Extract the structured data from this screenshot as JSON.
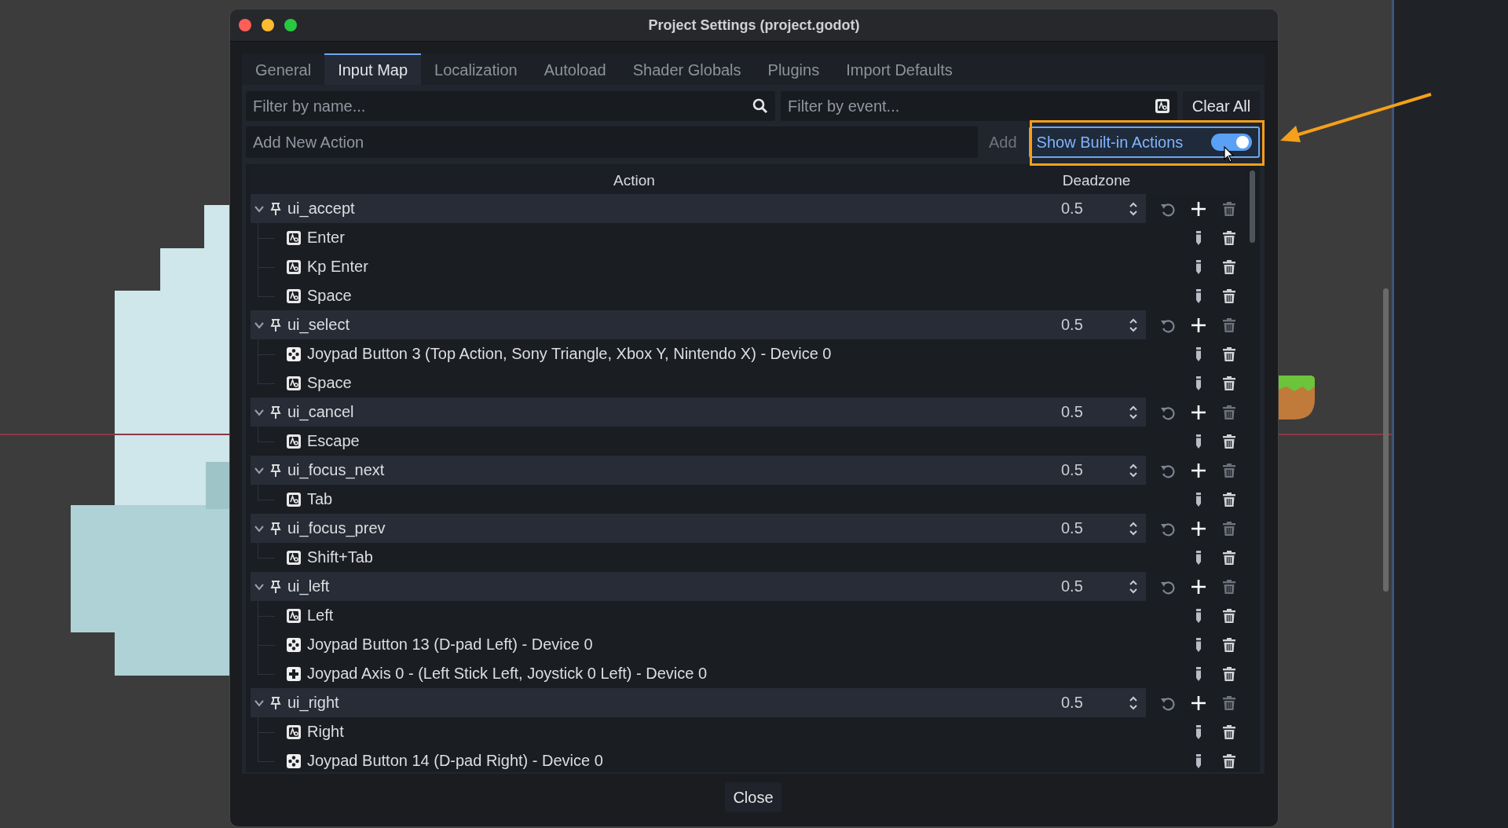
{
  "window": {
    "title": "Project Settings (project.godot)"
  },
  "tabs": [
    {
      "label": "General",
      "selected": false
    },
    {
      "label": "Input Map",
      "selected": true
    },
    {
      "label": "Localization",
      "selected": false
    },
    {
      "label": "Autoload",
      "selected": false
    },
    {
      "label": "Shader Globals",
      "selected": false
    },
    {
      "label": "Plugins",
      "selected": false
    },
    {
      "label": "Import Defaults",
      "selected": false
    }
  ],
  "filters": {
    "name_placeholder": "Filter by name...",
    "event_placeholder": "Filter by event...",
    "clear_button": "Clear All"
  },
  "add_action": {
    "placeholder": "Add New Action",
    "button": "Add",
    "button_disabled": true
  },
  "builtin_toggle": {
    "label": "Show Built-in Actions",
    "on": true
  },
  "table": {
    "columns": [
      "Action",
      "Deadzone"
    ],
    "actions": [
      {
        "name": "ui_accept",
        "expanded": true,
        "deadzone": "0.5",
        "events": [
          {
            "kind": "key",
            "label": "Enter"
          },
          {
            "kind": "key",
            "label": "Kp Enter"
          },
          {
            "kind": "key",
            "label": "Space"
          }
        ]
      },
      {
        "name": "ui_select",
        "expanded": true,
        "deadzone": "0.5",
        "events": [
          {
            "kind": "joypad_button",
            "label": "Joypad Button 3 (Top Action, Sony Triangle, Xbox Y, Nintendo X) - Device 0"
          },
          {
            "kind": "key",
            "label": "Space"
          }
        ]
      },
      {
        "name": "ui_cancel",
        "expanded": true,
        "deadzone": "0.5",
        "events": [
          {
            "kind": "key",
            "label": "Escape"
          }
        ]
      },
      {
        "name": "ui_focus_next",
        "expanded": true,
        "deadzone": "0.5",
        "events": [
          {
            "kind": "key",
            "label": "Tab"
          }
        ]
      },
      {
        "name": "ui_focus_prev",
        "expanded": true,
        "deadzone": "0.5",
        "events": [
          {
            "kind": "key",
            "label": "Shift+Tab"
          }
        ]
      },
      {
        "name": "ui_left",
        "expanded": true,
        "deadzone": "0.5",
        "events": [
          {
            "kind": "key",
            "label": "Left"
          },
          {
            "kind": "joypad_button",
            "label": "Joypad Button 13 (D-pad Left) - Device 0"
          },
          {
            "kind": "joypad_axis",
            "label": "Joypad Axis 0 - (Left Stick Left, Joystick 0 Left) - Device 0"
          }
        ]
      },
      {
        "name": "ui_right",
        "expanded": true,
        "deadzone": "0.5",
        "events": [
          {
            "kind": "key",
            "label": "Right"
          },
          {
            "kind": "joypad_button",
            "label": "Joypad Button 14 (D-pad Right) - Device 0"
          }
        ]
      }
    ]
  },
  "footer": {
    "close_button": "Close"
  }
}
